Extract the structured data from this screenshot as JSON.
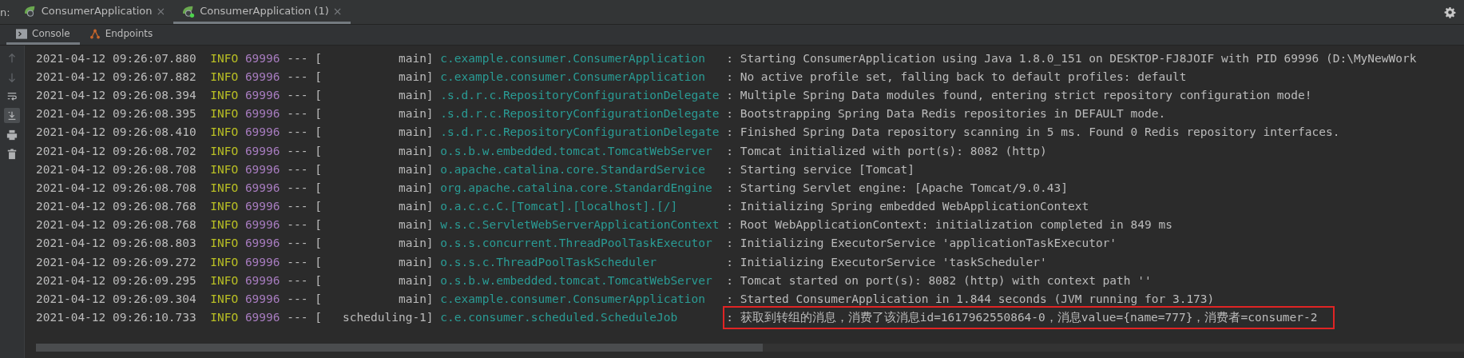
{
  "run_label": "n:",
  "run_tabs": [
    {
      "label": "ConsumerApplication",
      "close": "×",
      "selected": false,
      "running": false
    },
    {
      "label": "ConsumerApplication (1)",
      "close": "×",
      "selected": true,
      "running": true
    }
  ],
  "tool_tabs": [
    {
      "label": "Console",
      "kind": "console",
      "selected": true
    },
    {
      "label": "Endpoints",
      "kind": "endpoints",
      "selected": false
    }
  ],
  "gutter_tools": [
    {
      "kind": "up",
      "selected": false
    },
    {
      "kind": "down",
      "selected": false
    },
    {
      "kind": "wrap",
      "selected": false
    },
    {
      "kind": "scroll-end",
      "selected": true
    },
    {
      "kind": "print",
      "selected": false
    },
    {
      "kind": "trash",
      "selected": false
    }
  ],
  "log_lines": [
    {
      "time": "2021-04-12 09:26:07.880",
      "level": "INFO",
      "pid": "69996",
      "sep": "--- [",
      "thread": "main]",
      "logger": "c.example.consumer.ConsumerApplication",
      "message": ": Starting ConsumerApplication using Java 1.8.0_151 on DESKTOP-FJ8JOIF with PID 69996 (D:\\MyNewWork",
      "highlighted": false
    },
    {
      "time": "2021-04-12 09:26:07.882",
      "level": "INFO",
      "pid": "69996",
      "sep": "--- [",
      "thread": "main]",
      "logger": "c.example.consumer.ConsumerApplication",
      "message": ": No active profile set, falling back to default profiles: default",
      "highlighted": false
    },
    {
      "time": "2021-04-12 09:26:08.394",
      "level": "INFO",
      "pid": "69996",
      "sep": "--- [",
      "thread": "main]",
      "logger": ".s.d.r.c.RepositoryConfigurationDelegate",
      "message": ": Multiple Spring Data modules found, entering strict repository configuration mode!",
      "highlighted": false
    },
    {
      "time": "2021-04-12 09:26:08.395",
      "level": "INFO",
      "pid": "69996",
      "sep": "--- [",
      "thread": "main]",
      "logger": ".s.d.r.c.RepositoryConfigurationDelegate",
      "message": ": Bootstrapping Spring Data Redis repositories in DEFAULT mode.",
      "highlighted": false
    },
    {
      "time": "2021-04-12 09:26:08.410",
      "level": "INFO",
      "pid": "69996",
      "sep": "--- [",
      "thread": "main]",
      "logger": ".s.d.r.c.RepositoryConfigurationDelegate",
      "message": ": Finished Spring Data repository scanning in 5 ms. Found 0 Redis repository interfaces.",
      "highlighted": false
    },
    {
      "time": "2021-04-12 09:26:08.702",
      "level": "INFO",
      "pid": "69996",
      "sep": "--- [",
      "thread": "main]",
      "logger": "o.s.b.w.embedded.tomcat.TomcatWebServer",
      "message": ": Tomcat initialized with port(s): 8082 (http)",
      "highlighted": false
    },
    {
      "time": "2021-04-12 09:26:08.708",
      "level": "INFO",
      "pid": "69996",
      "sep": "--- [",
      "thread": "main]",
      "logger": "o.apache.catalina.core.StandardService",
      "message": ": Starting service [Tomcat]",
      "highlighted": false
    },
    {
      "time": "2021-04-12 09:26:08.708",
      "level": "INFO",
      "pid": "69996",
      "sep": "--- [",
      "thread": "main]",
      "logger": "org.apache.catalina.core.StandardEngine",
      "message": ": Starting Servlet engine: [Apache Tomcat/9.0.43]",
      "highlighted": false
    },
    {
      "time": "2021-04-12 09:26:08.768",
      "level": "INFO",
      "pid": "69996",
      "sep": "--- [",
      "thread": "main]",
      "logger": "o.a.c.c.C.[Tomcat].[localhost].[/]",
      "message": ": Initializing Spring embedded WebApplicationContext",
      "highlighted": false
    },
    {
      "time": "2021-04-12 09:26:08.768",
      "level": "INFO",
      "pid": "69996",
      "sep": "--- [",
      "thread": "main]",
      "logger": "w.s.c.ServletWebServerApplicationContext",
      "message": ": Root WebApplicationContext: initialization completed in 849 ms",
      "highlighted": false
    },
    {
      "time": "2021-04-12 09:26:08.803",
      "level": "INFO",
      "pid": "69996",
      "sep": "--- [",
      "thread": "main]",
      "logger": "o.s.s.concurrent.ThreadPoolTaskExecutor",
      "message": ": Initializing ExecutorService 'applicationTaskExecutor'",
      "highlighted": false
    },
    {
      "time": "2021-04-12 09:26:09.272",
      "level": "INFO",
      "pid": "69996",
      "sep": "--- [",
      "thread": "main]",
      "logger": "o.s.s.c.ThreadPoolTaskScheduler",
      "message": ": Initializing ExecutorService 'taskScheduler'",
      "highlighted": false
    },
    {
      "time": "2021-04-12 09:26:09.295",
      "level": "INFO",
      "pid": "69996",
      "sep": "--- [",
      "thread": "main]",
      "logger": "o.s.b.w.embedded.tomcat.TomcatWebServer",
      "message": ": Tomcat started on port(s): 8082 (http) with context path ''",
      "highlighted": false
    },
    {
      "time": "2021-04-12 09:26:09.304",
      "level": "INFO",
      "pid": "69996",
      "sep": "--- [",
      "thread": "main]",
      "logger": "c.example.consumer.ConsumerApplication",
      "message": ": Started ConsumerApplication in 1.844 seconds (JVM running for 3.173)",
      "highlighted": false
    },
    {
      "time": "2021-04-12 09:26:10.733",
      "level": "INFO",
      "pid": "69996",
      "sep": "--- [",
      "thread": "scheduling-1]",
      "logger": "c.e.consumer.scheduled.ScheduleJob",
      "message": ": 获取到转组的消息，消费了该消息id=1617962550864-0，消息value={name=777}，消费者=consumer-2",
      "highlighted": true
    }
  ]
}
